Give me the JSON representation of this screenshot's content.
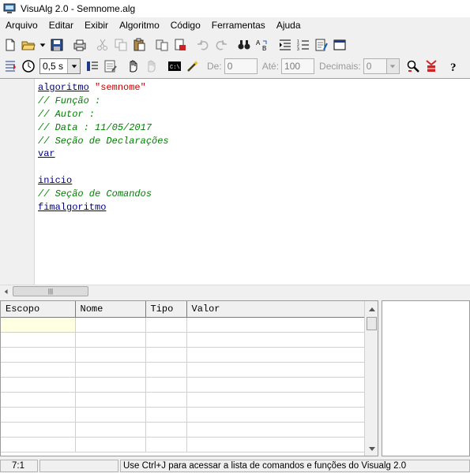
{
  "window": {
    "title": "VisuAlg 2.0 - Semnome.alg"
  },
  "menu": [
    "Arquivo",
    "Editar",
    "Exibir",
    "Algoritmo",
    "Código",
    "Ferramentas",
    "Ajuda"
  ],
  "toolbar2": {
    "speed": "0,5 s",
    "de_label": "De:",
    "de_value": "0",
    "ate_label": "Até:",
    "ate_value": "100",
    "decimais_label": "Decimais:",
    "decimais_value": "0"
  },
  "code": {
    "l1_kw": "algoritmo",
    "l1_str": "\"semnome\"",
    "l2": "// Função :",
    "l3": "// Autor :",
    "l4": "// Data : 11/05/2017",
    "l5": "// Seção de Declarações",
    "l6_kw": "var",
    "l8_kw": "inicio",
    "l9": "// Seção de Comandos",
    "l10_kw": "fimalgoritmo"
  },
  "grid": {
    "columns": [
      "Escopo",
      "Nome",
      "Tipo",
      "Valor"
    ]
  },
  "status": {
    "position": "7:1",
    "hint": "Use Ctrl+J para acessar a lista de comandos e funções do Visualg 2.0"
  },
  "colors": {
    "keyword": "#000080",
    "string": "#cc0000",
    "comment": "#008000",
    "selected_cell": "#ffffe1"
  }
}
